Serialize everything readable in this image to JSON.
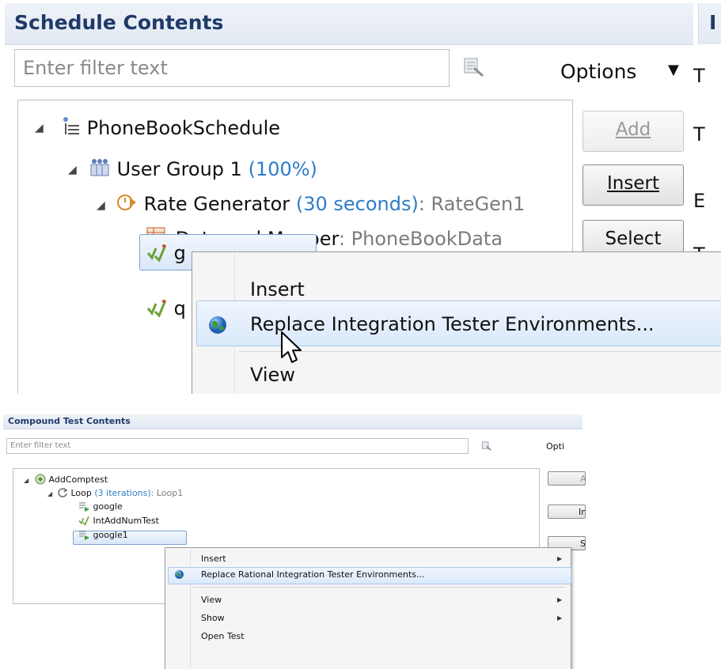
{
  "top_panel": {
    "title": "Schedule Contents",
    "right_title": "I",
    "filter_placeholder": "Enter filter text",
    "options_label": "Options",
    "right_labels": [
      "T",
      "T",
      "E",
      "T"
    ],
    "tree": {
      "schedule": "PhoneBookSchedule",
      "user_group": "User Group 1",
      "user_group_pct": "(100%)",
      "rate_gen": "Rate Generator",
      "rate_gen_duration": "(30 seconds)",
      "rate_gen_name": ": RateGen1",
      "datapool_label": "Datapool Mapper",
      "datapool_value": ": PhoneBookData",
      "item_g": "g",
      "item_q": "q"
    },
    "buttons": {
      "add": "Add",
      "insert": "Insert",
      "select": "Select"
    },
    "context_menu": {
      "insert": "Insert",
      "replace": "Replace Integration Tester Environments...",
      "view": "View"
    }
  },
  "bottom_panel": {
    "title": "Compound Test Contents",
    "filter_placeholder": "Enter filter text",
    "options_label": "Opti",
    "tree": {
      "root": "AddComptest",
      "loop": "Loop",
      "loop_iterations": "(3 iterations)",
      "loop_name": ": Loop1",
      "google": "google",
      "intaddnum": "IntAddNumTest",
      "google1": "google1"
    },
    "buttons": [
      "A",
      "In",
      "S"
    ],
    "context_menu": {
      "insert": "Insert",
      "replace": "Replace Rational Integration Tester Environments...",
      "view": "View",
      "show": "Show",
      "open_test": "Open Test"
    }
  }
}
